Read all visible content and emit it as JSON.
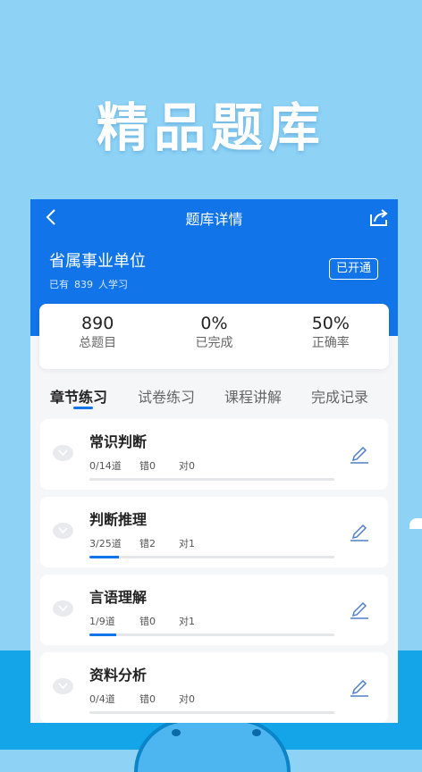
{
  "hero": {
    "title": "精品题库"
  },
  "nav": {
    "title": "题库详情",
    "back_icon": "chevron-left-icon",
    "share_icon": "share-icon"
  },
  "bank": {
    "name": "省属事业单位",
    "learner_prefix": "已有",
    "learner_count": "839",
    "learner_suffix": "人学习",
    "badge": "已开通"
  },
  "stats": [
    {
      "value": "890",
      "label": "总题目"
    },
    {
      "value": "0%",
      "label": "已完成"
    },
    {
      "value": "50%",
      "label": "正确率"
    }
  ],
  "tabs": [
    {
      "label": "章节练习",
      "active": true
    },
    {
      "label": "试卷练习",
      "active": false
    },
    {
      "label": "课程讲解",
      "active": false
    },
    {
      "label": "完成记录",
      "active": false
    }
  ],
  "chapters": [
    {
      "name": "常识判断",
      "done": "0/14道",
      "wrong": "错0",
      "right": "对0",
      "progress": 0.0
    },
    {
      "name": "判断推理",
      "done": "3/25道",
      "wrong": "错2",
      "right": "对1",
      "progress": 0.12
    },
    {
      "name": "言语理解",
      "done": "1/9道",
      "wrong": "错0",
      "right": "对1",
      "progress": 0.11
    },
    {
      "name": "资料分析",
      "done": "0/4道",
      "wrong": "错0",
      "right": "对0",
      "progress": 0.0
    }
  ],
  "colors": {
    "brand": "#1174e8",
    "background": "#8ed3f6",
    "bottom_band": "#14a5e8"
  }
}
